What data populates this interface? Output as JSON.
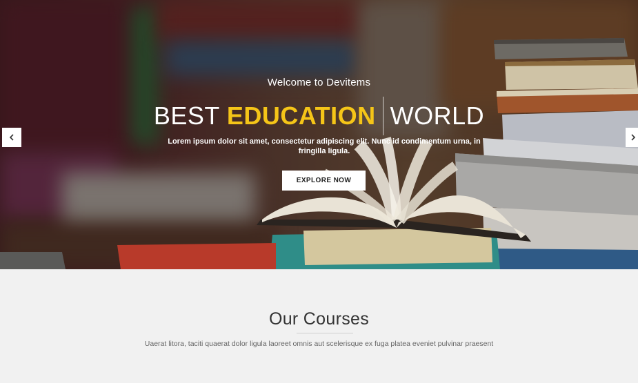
{
  "hero": {
    "welcome": "Welcome to Devitems",
    "headline_part1": "BEST",
    "headline_highlight": "EDUCATION",
    "headline_part2": "WORLD",
    "lead": "Lorem ipsum dolor sit amet, consectetur adipiscing elit. Nunc id condimentum urna, in fringilla ligula.",
    "button_label": "EXPLORE NOW",
    "highlight_color": "#f5c518",
    "prev_icon": "chevron-left-icon",
    "next_icon": "chevron-right-icon"
  },
  "courses": {
    "title": "Our Courses",
    "subtitle": "Uaerat litora, taciti quaerat dolor ligula laoreet omnis aut scelerisque ex fuga platea eveniet pulvinar praesent"
  }
}
